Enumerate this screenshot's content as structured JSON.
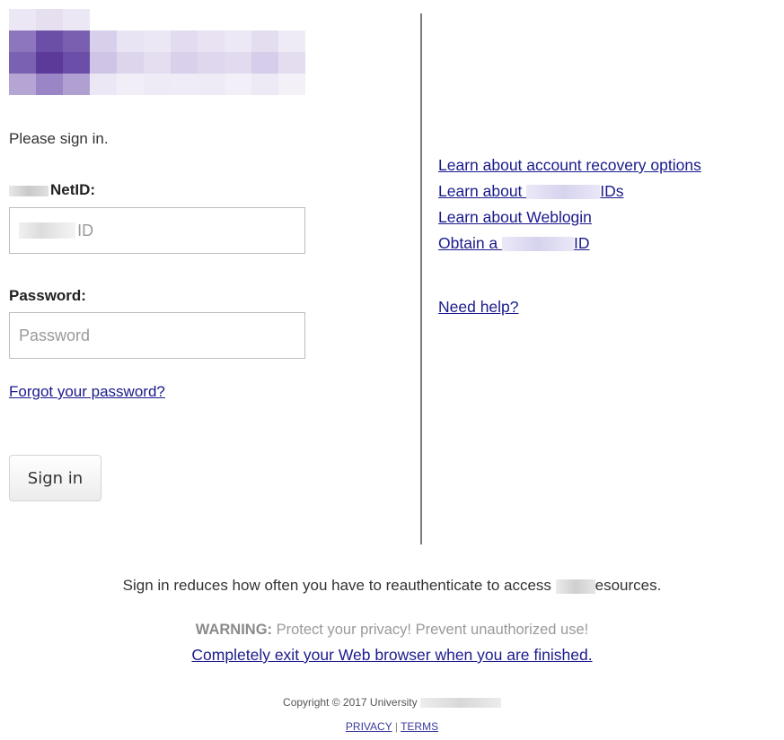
{
  "logo": {
    "brand_color": "#5b3a9a"
  },
  "form": {
    "prompt": "Please sign in.",
    "netid_label": "NetID:",
    "netid_placeholder": "ID",
    "password_label": "Password:",
    "password_placeholder": "Password",
    "forgot_link": "Forgot your password?",
    "submit_label": "Sign in"
  },
  "links": {
    "recovery": "Learn about account recovery options",
    "learn_ids_prefix": "Learn about ",
    "learn_ids_suffix": "IDs",
    "weblogin": "Learn about Weblogin",
    "obtain_prefix": "Obtain a ",
    "obtain_suffix": "ID",
    "help": "Need help?"
  },
  "footer": {
    "reauth_prefix": "Sign in reduces how often you have to reauthenticate to access ",
    "reauth_suffix": "esources.",
    "warning_label": "WARNING:",
    "warning_text": " Protect your privacy! Prevent unauthorized use!",
    "exit_link": "Completely exit your Web browser when you are finished.",
    "copyright": "Copyright © 2017 University",
    "privacy": "PRIVACY",
    "separator": " | ",
    "terms": "TERMS"
  }
}
